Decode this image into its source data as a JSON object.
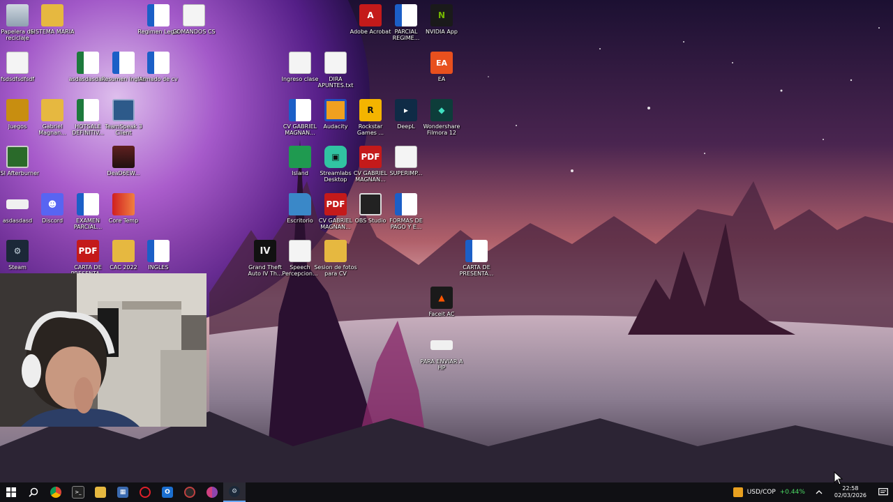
{
  "desktop": {
    "icons": [
      {
        "label": "Papelera de reciclaje",
        "type": "bin"
      },
      {
        "label": "SISTEMA MARIA",
        "type": "folder"
      },
      {
        "label": "Regimen Legal",
        "type": "word"
      },
      {
        "label": "COMANDOS CS",
        "type": "doc"
      },
      {
        "label": "Adobe Acrobat",
        "type": "acrobat"
      },
      {
        "label": "PARCIAL REGIME...",
        "type": "word"
      },
      {
        "label": "NVIDIA App",
        "type": "nvidia"
      },
      {
        "label": "fsdsdfsdfsdf",
        "type": "doc"
      },
      {
        "label": "asdasdasda...",
        "type": "excel"
      },
      {
        "label": "Resumen Ingles",
        "type": "word"
      },
      {
        "label": "Armado de cv",
        "type": "word"
      },
      {
        "label": "Ingreso clase",
        "type": "doc"
      },
      {
        "label": "DIRA APUNTES.txt",
        "type": "doc"
      },
      {
        "label": "EA",
        "type": "ea"
      },
      {
        "label": "Juegos",
        "type": "folder-dark"
      },
      {
        "label": "Gabriel Magnan...",
        "type": "folder-person"
      },
      {
        "label": "HOTSALE DEFINITIV...",
        "type": "excel"
      },
      {
        "label": "TeamSpeak 3 Client",
        "type": "teamspeak"
      },
      {
        "label": "CV GABRIEL MAGNAN...",
        "type": "word"
      },
      {
        "label": "Audacity",
        "type": "audacity"
      },
      {
        "label": "Rockstar Games ...",
        "type": "rockstar"
      },
      {
        "label": "DeepL",
        "type": "deepl"
      },
      {
        "label": "Wondershare Filmora 12",
        "type": "filmora"
      },
      {
        "label": "MSI Afterburner",
        "type": "msi"
      },
      {
        "label": "DeaD6EW...",
        "type": "image"
      },
      {
        "label": "Island",
        "type": "island"
      },
      {
        "label": "Streamlabs Desktop",
        "type": "streamlabs"
      },
      {
        "label": "CV GABRIEL MAGNAN...",
        "type": "pdf"
      },
      {
        "label": "SUPERIMP...",
        "type": "doc"
      },
      {
        "label": "asdasdasd",
        "type": "blank"
      },
      {
        "label": "Discord",
        "type": "discord"
      },
      {
        "label": "EXAMEN PARCIAL...",
        "type": "word"
      },
      {
        "label": "Core Temp",
        "type": "coretemp"
      },
      {
        "label": "Escritorio",
        "type": "escritorio"
      },
      {
        "label": "CV GABRIEL MAGNAN...",
        "type": "pdf"
      },
      {
        "label": "OBS Studio",
        "type": "obs"
      },
      {
        "label": "FORMAS DE PAGO Y E...",
        "type": "word"
      },
      {
        "label": "Steam",
        "type": "steam"
      },
      {
        "label": "CARTA DE PRESENTA...",
        "type": "pdf"
      },
      {
        "label": "CAC 2022",
        "type": "folder"
      },
      {
        "label": "INGLES",
        "type": "word"
      },
      {
        "label": "Grand Theft Auto IV Th...",
        "type": "gta"
      },
      {
        "label": "Speech Percepcion...",
        "type": "doc"
      },
      {
        "label": "Sesion de fotos para CV",
        "type": "folder-person"
      },
      {
        "label": "CARTA DE PRESENTA...",
        "type": "word"
      },
      {
        "label": "Faceit AC",
        "type": "faceit"
      },
      {
        "label": "PARA ENVIAR A HP",
        "type": "blank"
      }
    ]
  },
  "taskbar": {
    "apps": [
      {
        "name": "start-button",
        "glyph": "⊞",
        "color": "#ffffff"
      },
      {
        "name": "search-icon",
        "glyph": "⌕",
        "color": "#ffffff"
      },
      {
        "name": "chrome-icon",
        "glyph": "●",
        "color": "#2f8af5"
      },
      {
        "name": "terminal-icon",
        "glyph": ">_",
        "color": "#cccccc"
      },
      {
        "name": "file-explorer-icon",
        "glyph": "▤",
        "color": "#e6b840"
      },
      {
        "name": "calculator-icon",
        "glyph": "▦",
        "color": "#5a8bd6"
      },
      {
        "name": "opera-icon",
        "glyph": "O",
        "color": "#e0202a"
      },
      {
        "name": "outlook-icon",
        "glyph": "O",
        "color": "#1b6fd0"
      },
      {
        "name": "capture-icon",
        "glyph": "◎",
        "color": "#d04040"
      },
      {
        "name": "chrome-profile-icon",
        "glyph": "●",
        "color": "#8e44ad"
      },
      {
        "name": "steam-icon",
        "glyph": "⚙",
        "color": "#c7d5e0"
      }
    ],
    "ticker_label": "USD/COP",
    "ticker_change": "+0.44%",
    "ticker_color": "#4cd964",
    "time": "22:58",
    "date": "02/03/2026"
  }
}
